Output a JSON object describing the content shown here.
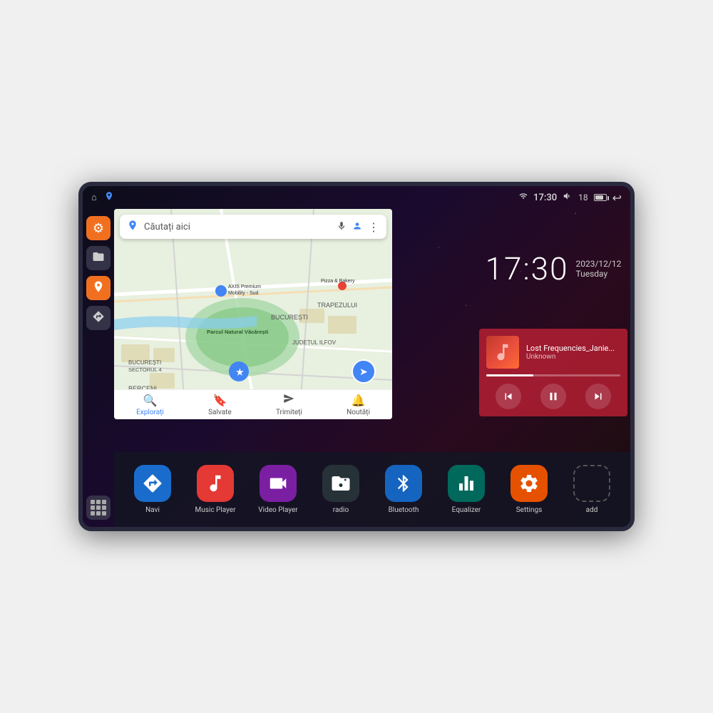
{
  "device": {
    "status_bar": {
      "left_icons": [
        "home",
        "map-pin"
      ],
      "wifi_signal": "▾",
      "time": "17:30",
      "volume_icon": "🔊",
      "battery_level": "18",
      "battery_icon": "battery",
      "back_icon": "↩"
    },
    "sidebar": {
      "items": [
        {
          "id": "settings",
          "icon": "⚙",
          "color": "orange"
        },
        {
          "id": "files",
          "icon": "🗂",
          "color": "dark"
        },
        {
          "id": "maps",
          "icon": "📍",
          "color": "orange"
        },
        {
          "id": "navigation",
          "icon": "➤",
          "color": "dark"
        }
      ],
      "apps_grid_label": "apps"
    },
    "map": {
      "search_placeholder": "Căutați aici",
      "location_label": "AXIS Premium Mobility - Sud",
      "poi_label": "Pizza & Bakery",
      "park_label": "Parcul Natural Văcărești",
      "district_label": "BUCUREȘTI",
      "district2_label": "BUCUREȘTI SECTORUL 4",
      "district3_label": "JUDEȚUL ILFOV",
      "area_label": "BERCENI",
      "area2_label": "TRAPEZULUI",
      "bottom_nav": [
        {
          "id": "explore",
          "label": "Explorați",
          "icon": "🔍"
        },
        {
          "id": "saved",
          "label": "Salvate",
          "icon": "🔖"
        },
        {
          "id": "share",
          "label": "Trimiteți",
          "icon": "➤"
        },
        {
          "id": "news",
          "label": "Noutăți",
          "icon": "🔔"
        }
      ]
    },
    "clock": {
      "time": "17:30",
      "date": "2023/12/12",
      "day": "Tuesday"
    },
    "player": {
      "track_name": "Lost Frequencies_Janie...",
      "artist": "Unknown",
      "controls": {
        "prev": "⏮",
        "pause": "⏸",
        "next": "⏭"
      }
    },
    "apps": [
      {
        "id": "navi",
        "label": "Navi",
        "icon": "➤",
        "color": "blue-nav"
      },
      {
        "id": "music-player",
        "label": "Music Player",
        "icon": "♪",
        "color": "red-music"
      },
      {
        "id": "video-player",
        "label": "Video Player",
        "icon": "▶",
        "color": "purple-video"
      },
      {
        "id": "radio",
        "label": "radio",
        "icon": "📻",
        "color": "dark-radio"
      },
      {
        "id": "bluetooth",
        "label": "Bluetooth",
        "icon": "⚡",
        "color": "blue-bt"
      },
      {
        "id": "equalizer",
        "label": "Equalizer",
        "icon": "🎚",
        "color": "teal-eq"
      },
      {
        "id": "settings",
        "label": "Settings",
        "icon": "⚙",
        "color": "orange-set"
      },
      {
        "id": "add",
        "label": "add",
        "icon": "+",
        "color": "grid-add"
      }
    ]
  }
}
